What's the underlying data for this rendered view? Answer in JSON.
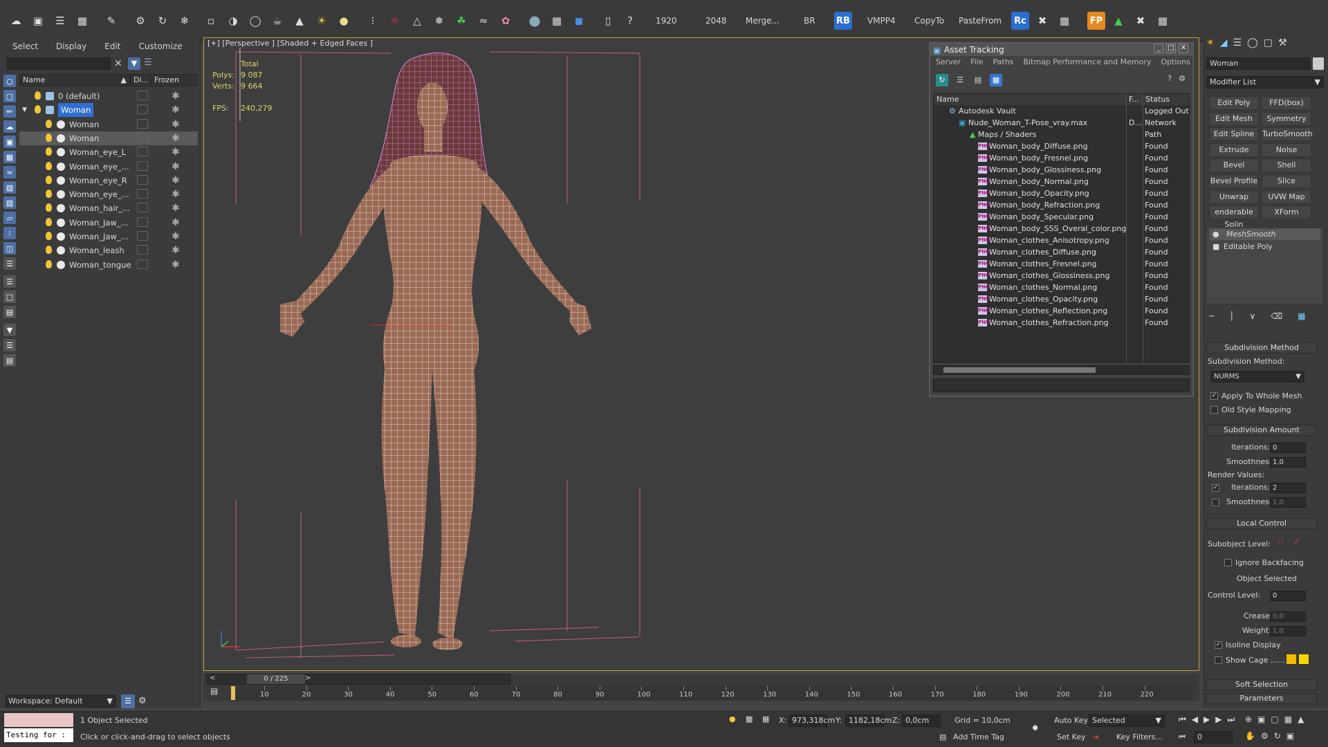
{
  "toolbar": {
    "texts": [
      "1920",
      "2048",
      "Merge...",
      "BR",
      "VMPP4",
      "CopyTo",
      "PasteFrom"
    ],
    "rb_badge": "RB",
    "rc_badge": "Rc",
    "fp_badge": "FP"
  },
  "explorer": {
    "menu": [
      "Select",
      "Display",
      "Edit",
      "Customize"
    ],
    "columns": {
      "name": "Name",
      "display": "Di...",
      "frozen": "Frozen"
    },
    "items": [
      {
        "label": "0 (default)",
        "level": 0
      },
      {
        "label": "Woman",
        "level": 0,
        "selected": true
      },
      {
        "label": "Woman",
        "level": 1
      },
      {
        "label": "Woman",
        "level": 1,
        "highlight": true
      },
      {
        "label": "Woman_eye_L",
        "level": 1
      },
      {
        "label": "Woman_eye_...",
        "level": 1
      },
      {
        "label": "Woman_eye_R",
        "level": 1
      },
      {
        "label": "Woman_eye_...",
        "level": 1
      },
      {
        "label": "Woman_hair_...",
        "level": 1
      },
      {
        "label": "Woman_Jaw_...",
        "level": 1
      },
      {
        "label": "Woman_Jaw_...",
        "level": 1
      },
      {
        "label": "Woman_leash",
        "level": 1
      },
      {
        "label": "Woman_tongue",
        "level": 1
      }
    ],
    "workspace": "Workspace: Default"
  },
  "viewport": {
    "label": "[+] [Perspective ] [Shaded + Edged Faces ]",
    "stats": {
      "total_label": "Total",
      "polys_label": "Polys:",
      "polys_value": "9 087",
      "verts_label": "Verts:",
      "verts_value": "9 664",
      "fps_label": "FPS:",
      "fps_value": "240,279"
    }
  },
  "asset_tracking": {
    "title": "Asset Tracking",
    "menu": [
      "Server",
      "File",
      "Paths",
      "Bitmap Performance and Memory",
      "Options"
    ],
    "columns": {
      "name": "Name",
      "f": "F...",
      "status": "Status"
    },
    "vault": {
      "name": "Autodesk Vault",
      "status": "Logged Out"
    },
    "file": {
      "name": "Nude_Woman_T-Pose_vray.max",
      "f": "D...",
      "status": "Network Path"
    },
    "maps_folder": "Maps / Shaders",
    "maps": [
      {
        "name": "Woman_body_Diffuse.png",
        "status": "Found"
      },
      {
        "name": "Woman_body_Fresnel.png",
        "status": "Found"
      },
      {
        "name": "Woman_body_Glossiness.png",
        "status": "Found"
      },
      {
        "name": "Woman_body_Normal.png",
        "status": "Found"
      },
      {
        "name": "Woman_body_Opacity.png",
        "status": "Found"
      },
      {
        "name": "Woman_body_Refraction.png",
        "status": "Found"
      },
      {
        "name": "Woman_body_Specular.png",
        "status": "Found"
      },
      {
        "name": "Woman_body_SSS_Overal_color.png",
        "status": "Found"
      },
      {
        "name": "Woman_clothes_Anisotropy.png",
        "status": "Found"
      },
      {
        "name": "Woman_clothes_Diffuse.png",
        "status": "Found"
      },
      {
        "name": "Woman_clothes_Fresnel.png",
        "status": "Found"
      },
      {
        "name": "Woman_clothes_Glossiness.png",
        "status": "Found"
      },
      {
        "name": "Woman_clothes_Normal.png",
        "status": "Found"
      },
      {
        "name": "Woman_clothes_Opacity.png",
        "status": "Found"
      },
      {
        "name": "Woman_clothes_Reflection.png",
        "status": "Found"
      },
      {
        "name": "Woman_clothes_Refraction.png",
        "status": "Found"
      }
    ],
    "png_tag": "PNG"
  },
  "command_panel": {
    "object_name": "Woman",
    "modifier_list": "Modifier List",
    "modifier_buttons": [
      "Edit Poly",
      "FFD(box)",
      "Edit Mesh",
      "Symmetry",
      "Edit Spline",
      "TurboSmooth",
      "Extrude",
      "Noise",
      "Bevel",
      "Shell",
      "Bevel Profile",
      "Slice",
      "Unwrap UVW",
      "UVW Map",
      "enderable Splin",
      "XForm"
    ],
    "stack": [
      "MeshSmooth",
      "Editable Poly"
    ],
    "subdivision_method_title": "Subdivision Method",
    "subdivision_method_label": "Subdivision Method:",
    "subdivision_method_value": "NURMS",
    "apply_whole_mesh": "Apply To Whole Mesh",
    "old_style_mapping": "Old Style Mapping",
    "subdivision_amount_title": "Subdivision Amount",
    "iterations_label": "Iterations:",
    "iterations_value": "0",
    "smoothness_label": "Smoothness:",
    "smoothness_value": "1,0",
    "render_values_label": "Render Values:",
    "render_iterations_value": "2",
    "render_smoothness_value": "1,0",
    "local_control_title": "Local Control",
    "subobject_level_label": "Subobject Level:",
    "ignore_backfacing": "Ignore Backfacing",
    "object_selected": "Object Selected",
    "control_level_label": "Control Level:",
    "control_level_value": "0",
    "crease_label": "Crease:",
    "crease_value": "0,0",
    "weight_label": "Weight:",
    "weight_value": "1,0",
    "isoline_display": "Isoline Display",
    "show_cage": "Show Cage ......",
    "soft_selection_title": "Soft Selection",
    "parameters_title": "Parameters"
  },
  "timeline": {
    "frame_counter": "0 / 225",
    "ticks": [
      "10",
      "20",
      "30",
      "40",
      "50",
      "60",
      "70",
      "80",
      "90",
      "100",
      "110",
      "120",
      "130",
      "140",
      "150",
      "160",
      "170",
      "180",
      "190",
      "200",
      "210",
      "220"
    ]
  },
  "status": {
    "maxscript": "Testing for :",
    "selection": "1 Object Selected",
    "prompt": "Click or click-and-drag to select objects",
    "x_label": "X:",
    "x_value": "973,318cm",
    "y_label": "Y:",
    "y_value": "1182,18cm",
    "z_label": "Z:",
    "z_value": "0,0cm",
    "grid": "Grid = 10,0cm",
    "add_time_tag": "Add Time Tag",
    "auto_key": "Auto Key",
    "selected": "Selected",
    "set_key": "Set Key",
    "key_filters": "Key Filters...",
    "frame_value": "0"
  }
}
